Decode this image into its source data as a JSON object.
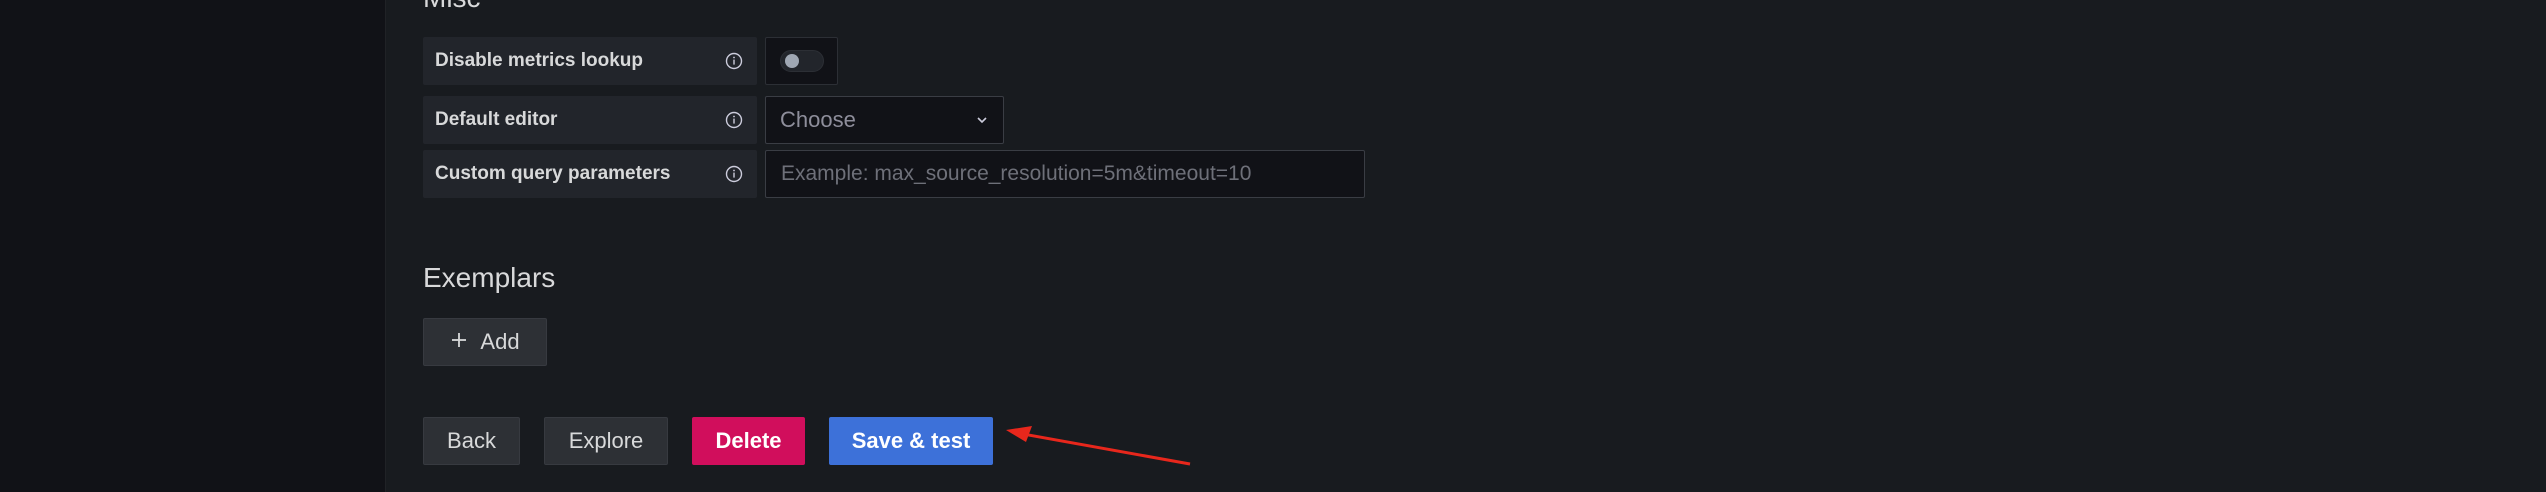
{
  "misc": {
    "title": "Misc",
    "disable_metrics_lookup": {
      "label": "Disable metrics lookup",
      "enabled": false
    },
    "default_editor": {
      "label": "Default editor",
      "value": "Choose"
    },
    "custom_query_parameters": {
      "label": "Custom query parameters",
      "placeholder": "Example: max_source_resolution=5m&timeout=10"
    }
  },
  "exemplars": {
    "title": "Exemplars",
    "add_label": "Add"
  },
  "actions": {
    "back": "Back",
    "explore": "Explore",
    "delete": "Delete",
    "save_test": "Save & test"
  },
  "colors": {
    "delete": "#d10e5c",
    "save": "#3d71d9",
    "annotation_arrow": "#e8271c"
  },
  "icons": {
    "info": "info-circle-icon",
    "chevron": "chevron-down-icon",
    "plus": "plus-icon"
  }
}
